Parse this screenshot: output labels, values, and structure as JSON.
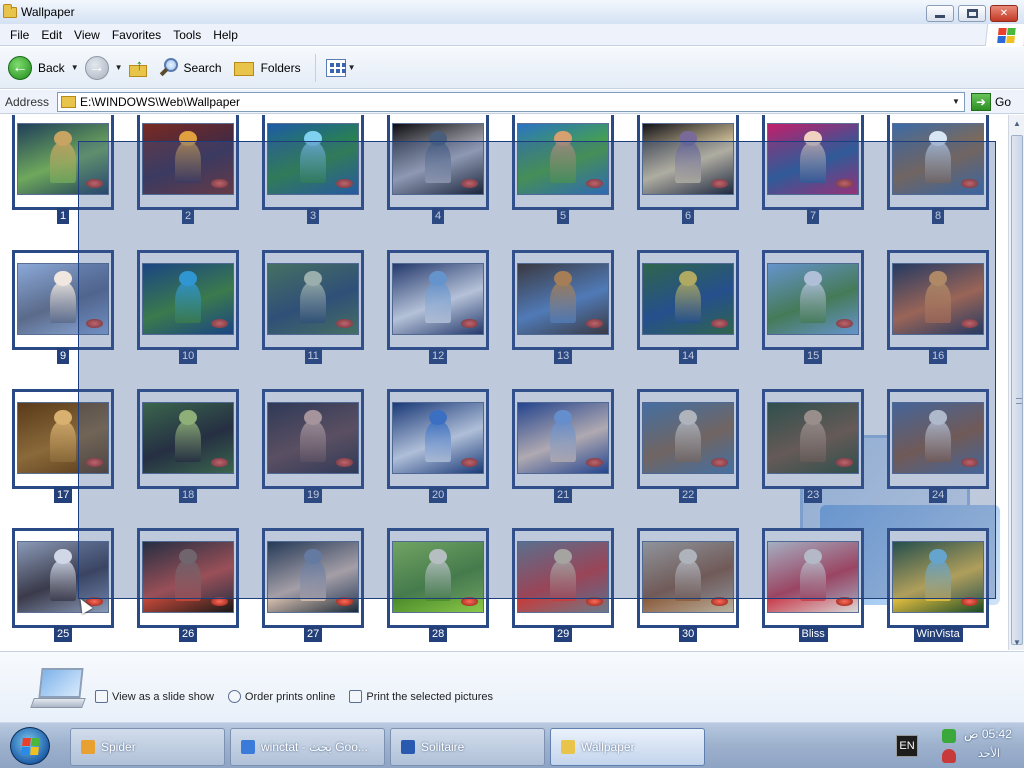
{
  "window": {
    "title": "Wallpaper",
    "minimize_label": "",
    "maximize_label": "",
    "close_label": "✕"
  },
  "menu": [
    "File",
    "Edit",
    "View",
    "Favorites",
    "Tools",
    "Help"
  ],
  "toolbar": {
    "back_label": "Back",
    "search_label": "Search",
    "folders_label": "Folders"
  },
  "address": {
    "label": "Address",
    "value": "E:\\WINDOWS\\Web\\Wallpaper",
    "go_label": "Go"
  },
  "thumbnails": [
    {
      "label": "1",
      "palette": [
        "#1f3f5a",
        "#c8a463",
        "#6fa85c"
      ]
    },
    {
      "label": "2",
      "palette": [
        "#7a2a22",
        "#e0a040",
        "#3a2a48"
      ]
    },
    {
      "label": "3",
      "palette": [
        "#1d5aa8",
        "#7fd1f0",
        "#2c8a3c"
      ]
    },
    {
      "label": "4",
      "palette": [
        "#0d0d12",
        "#4a5d7a",
        "#b7b7c2"
      ]
    },
    {
      "label": "5",
      "palette": [
        "#2a72c4",
        "#d6a070",
        "#4aa83a"
      ]
    },
    {
      "label": "6",
      "palette": [
        "#12121a",
        "#7a6a9a",
        "#e8d6a8"
      ]
    },
    {
      "label": "7",
      "palette": [
        "#c41e6a",
        "#f0d0c0",
        "#2a5a9a"
      ]
    },
    {
      "label": "8",
      "palette": [
        "#3a6aa8",
        "#d8e6f4",
        "#8a6a4a"
      ]
    },
    {
      "label": "9",
      "palette": [
        "#8aa8d8",
        "#f0e8e0",
        "#5a6a8a"
      ]
    },
    {
      "label": "10",
      "palette": [
        "#0a3a7a",
        "#2ab4f0",
        "#3a8a2a"
      ]
    },
    {
      "label": "11",
      "palette": [
        "#4a7a4a",
        "#c8d8b8",
        "#2a4a6a"
      ]
    },
    {
      "label": "12",
      "palette": [
        "#1a2a5a",
        "#7ab0e8",
        "#f0f4fa"
      ]
    },
    {
      "label": "13",
      "palette": [
        "#3a2a1a",
        "#d8903a",
        "#5a8ac8"
      ]
    },
    {
      "label": "14",
      "palette": [
        "#2a6a2a",
        "#e8d04a",
        "#1a4a8a"
      ]
    },
    {
      "label": "15",
      "palette": [
        "#7ab0e8",
        "#e8f0f8",
        "#4a8a3a"
      ]
    },
    {
      "label": "16",
      "palette": [
        "#1a2a4a",
        "#e8a050",
        "#c86a3a"
      ]
    },
    {
      "label": "17",
      "palette": [
        "#5a3a1a",
        "#d8b070",
        "#8a6a3a"
      ]
    },
    {
      "label": "18",
      "palette": [
        "#3a6a2a",
        "#b8d86a",
        "#1a1a1a"
      ]
    },
    {
      "label": "19",
      "palette": [
        "#2a2a3a",
        "#d8b0a0",
        "#6a4a4a"
      ]
    },
    {
      "label": "20",
      "palette": [
        "#0a2a6a",
        "#3a7ad8",
        "#e8f0fa"
      ]
    },
    {
      "label": "21",
      "palette": [
        "#1a3a8a",
        "#7aa8e8",
        "#e8d0c0"
      ]
    },
    {
      "label": "22",
      "palette": [
        "#4a7aa8",
        "#e8e0d0",
        "#8a6a4a"
      ]
    },
    {
      "label": "23",
      "palette": [
        "#2a4a2a",
        "#c8a888",
        "#7a5a3a"
      ]
    },
    {
      "label": "24",
      "palette": [
        "#4a6a9a",
        "#e8e8e8",
        "#8a5a3a"
      ]
    },
    {
      "label": "25",
      "palette": [
        "#8a9ab8",
        "#d0d8e8",
        "#3a3a4a"
      ]
    },
    {
      "label": "26",
      "palette": [
        "#1a1a1a",
        "#8a6a5a",
        "#c84a3a"
      ]
    },
    {
      "label": "27",
      "palette": [
        "#1a2a3a",
        "#7a8aa8",
        "#d8c0b0"
      ]
    },
    {
      "label": "28",
      "palette": [
        "#8ac84a",
        "#f0f0d8",
        "#4a8a2a"
      ]
    },
    {
      "label": "29",
      "palette": [
        "#6a7a8a",
        "#d8c8a8",
        "#c83a3a"
      ]
    },
    {
      "label": "30",
      "palette": [
        "#b8b0a0",
        "#e8e0d0",
        "#8a5a3a"
      ]
    },
    {
      "label": "Bliss",
      "palette": [
        "#d8d8d8",
        "#f0e8e0",
        "#c83a4a"
      ]
    },
    {
      "label": "WinVista",
      "palette": [
        "#1a4a2a",
        "#7ac8e8",
        "#e8c040"
      ]
    }
  ],
  "task_pane": {
    "slideshow_label": "View as a slide show",
    "order_prints_label": "Order prints online",
    "print_label": "Print the selected pictures"
  },
  "taskbar": {
    "items": [
      {
        "label": "Spider",
        "icon": "spider-solitaire-icon",
        "color": "#e8a030"
      },
      {
        "label": "winctat - بحث Goo...",
        "icon": "browser-icon",
        "color": "#3a7ad8"
      },
      {
        "label": "Solitaire",
        "icon": "solitaire-icon",
        "color": "#2a5ab0"
      },
      {
        "label": "Wallpaper",
        "icon": "folder-icon",
        "color": "#e8c54a"
      }
    ],
    "tray": {
      "lang_label": "EN",
      "time": "05:42 ص",
      "day": "الأحد"
    }
  },
  "colors": {
    "selection": "#3c5a96",
    "thumb_border": "#2a4a86",
    "label_bg": "#24407a"
  }
}
